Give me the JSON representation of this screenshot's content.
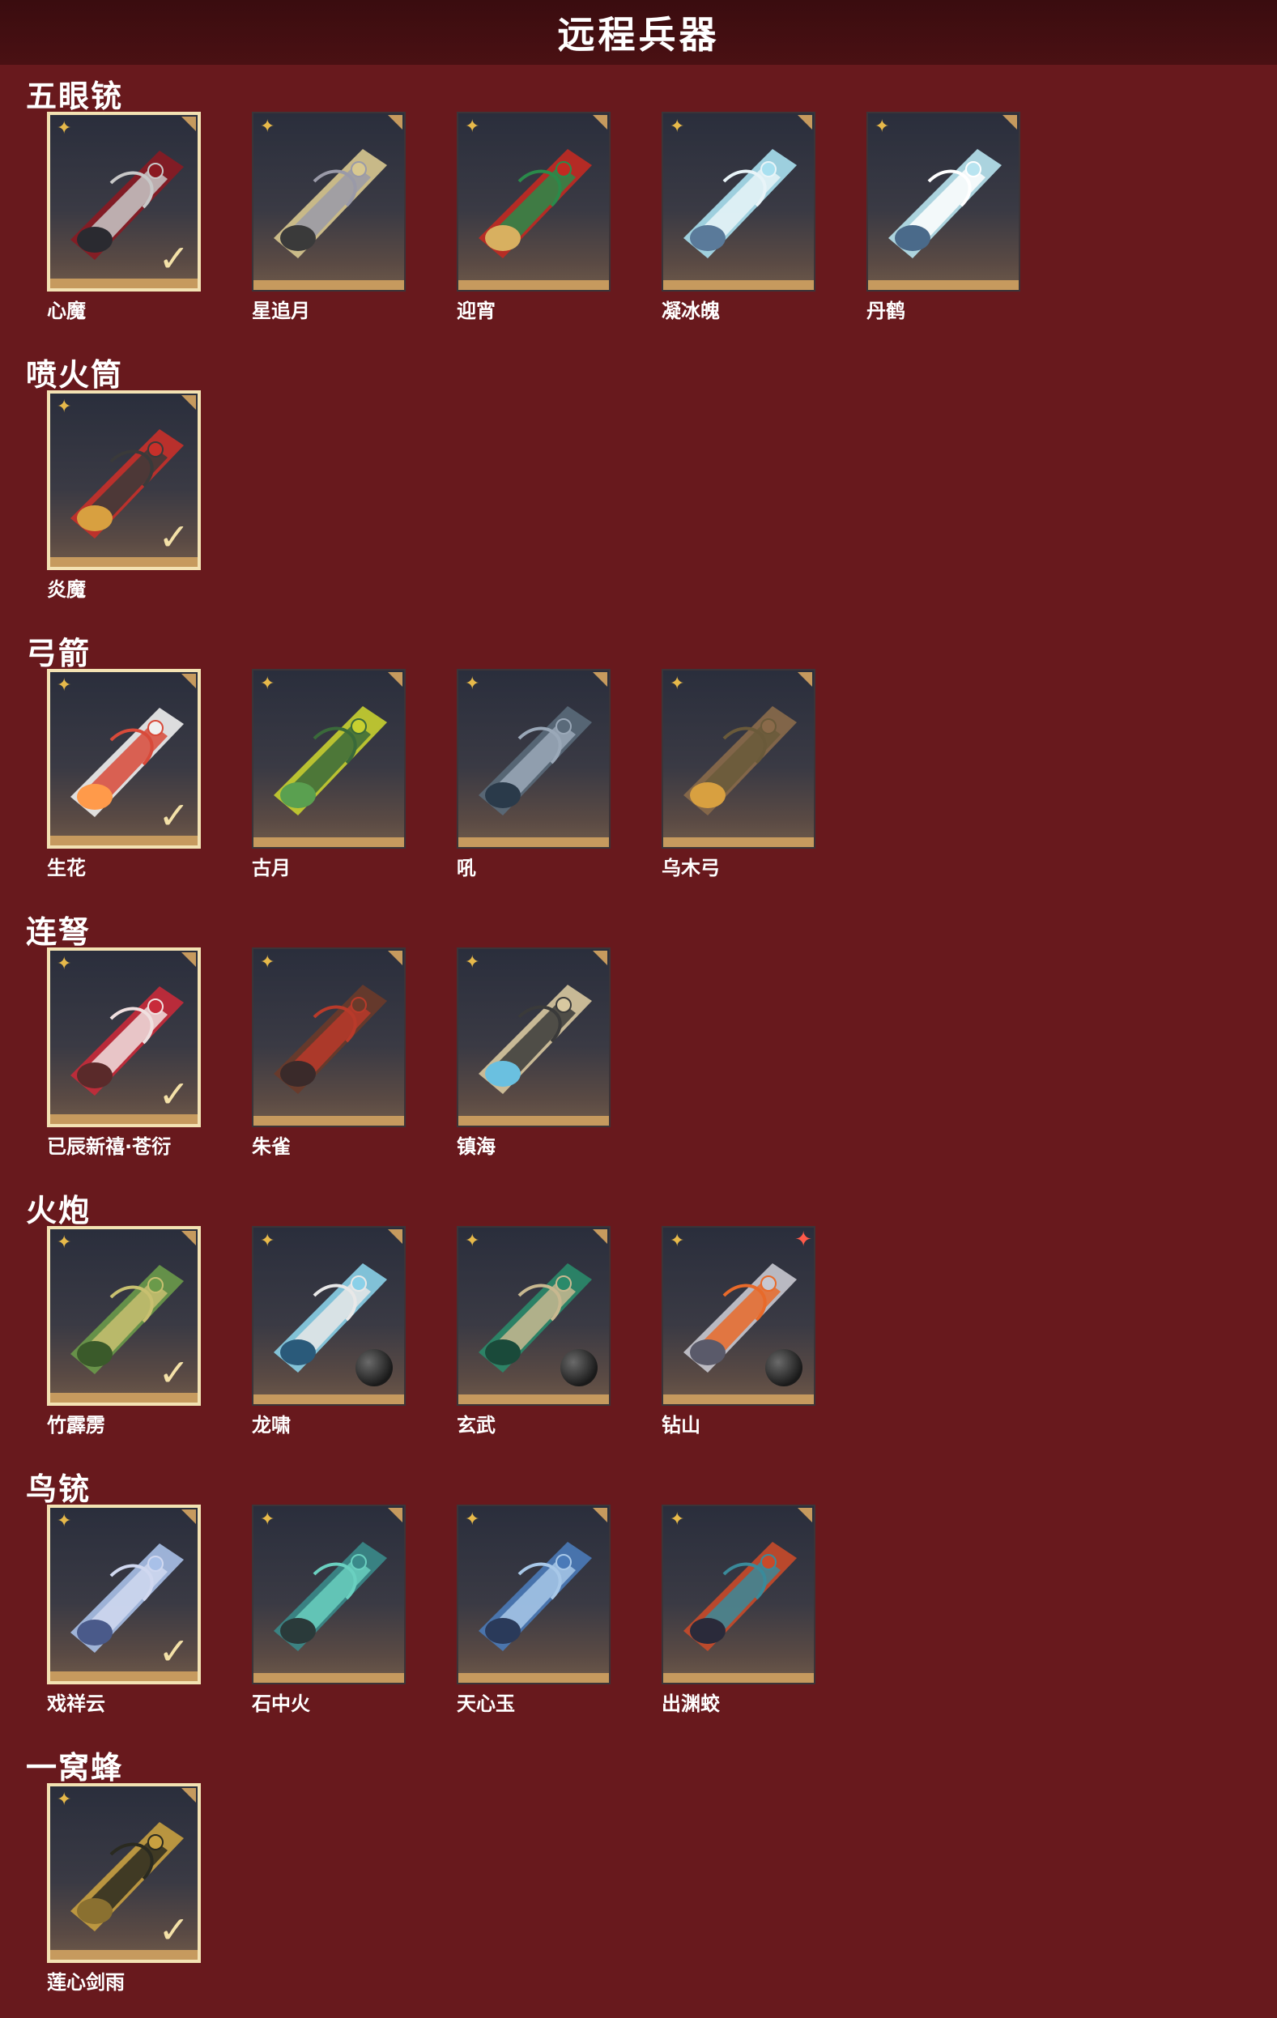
{
  "page_title": "远程兵器",
  "sections": [
    {
      "title": "五眼铳",
      "items": [
        {
          "name": "心魔",
          "owned": true
        },
        {
          "name": "星追月",
          "owned": false
        },
        {
          "name": "迎宵",
          "owned": false
        },
        {
          "name": "凝冰魄",
          "owned": false
        },
        {
          "name": "丹鹤",
          "owned": false
        }
      ]
    },
    {
      "title": "喷火筒",
      "items": [
        {
          "name": "炎魔",
          "owned": true
        }
      ]
    },
    {
      "title": "弓箭",
      "items": [
        {
          "name": "生花",
          "owned": true
        },
        {
          "name": "古月",
          "owned": false
        },
        {
          "name": "吼",
          "owned": false
        },
        {
          "name": "乌木弓",
          "owned": false
        }
      ]
    },
    {
      "title": "连弩",
      "items": [
        {
          "name": "已辰新禧·苍衍",
          "owned": true
        },
        {
          "name": "朱雀",
          "owned": false
        },
        {
          "name": "镇海",
          "owned": false
        }
      ]
    },
    {
      "title": "火炮",
      "items": [
        {
          "name": "竹霹雳",
          "owned": true
        },
        {
          "name": "龙啸",
          "owned": false
        },
        {
          "name": "玄武",
          "owned": false
        },
        {
          "name": "钻山",
          "owned": false,
          "new_badge": true
        }
      ]
    },
    {
      "title": "鸟铳",
      "items": [
        {
          "name": "戏祥云",
          "owned": true
        },
        {
          "name": "石中火",
          "owned": false
        },
        {
          "name": "天心玉",
          "owned": false
        },
        {
          "name": "出渊蛟",
          "owned": false
        }
      ]
    },
    {
      "title": "一窝蜂",
      "items": [
        {
          "name": "莲心剑雨",
          "owned": true
        }
      ]
    }
  ],
  "icons": {
    "rarity": "star-icon",
    "owned": "checkmark-icon",
    "badge": "new-badge-icon"
  },
  "colors": {
    "background": "#68191d",
    "title_bar": "#3a0c0f",
    "card_gold": "#c69a5e",
    "owned_border": "#f3e2b3"
  }
}
